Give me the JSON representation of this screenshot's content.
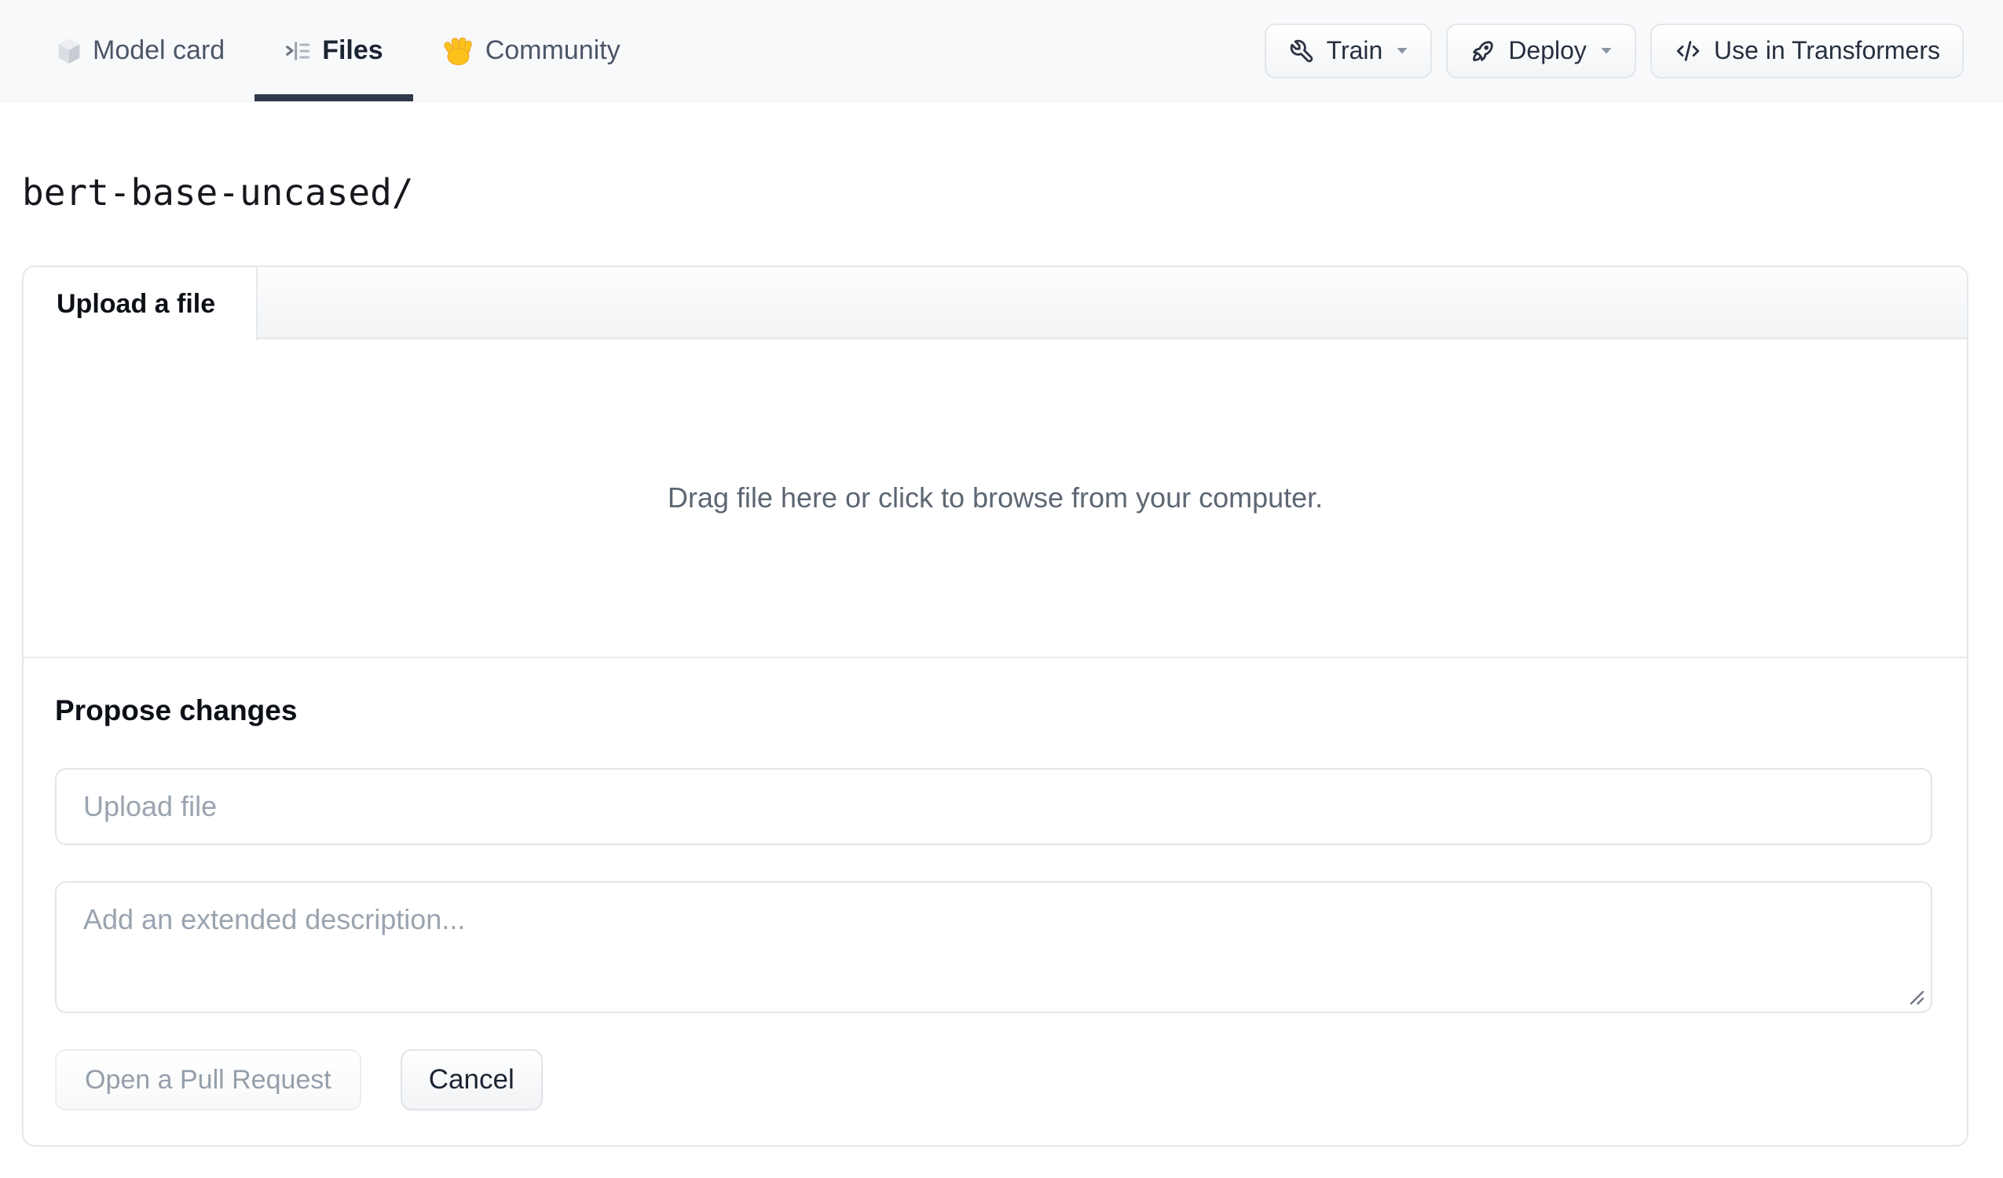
{
  "nav": {
    "tabs": [
      {
        "label": "Model card",
        "icon": "cube-icon",
        "active": false
      },
      {
        "label": "Files",
        "icon": "file-versions-icon",
        "active": true
      },
      {
        "label": "Community",
        "icon": "waving-hand-icon",
        "active": false
      }
    ],
    "actions": [
      {
        "label": "Train",
        "icon": "wrench-icon",
        "dropdown": true
      },
      {
        "label": "Deploy",
        "icon": "rocket-icon",
        "dropdown": true
      },
      {
        "label": "Use in Transformers",
        "icon": "code-icon",
        "dropdown": false
      }
    ]
  },
  "breadcrumb": {
    "repo_path": "bert-base-uncased/"
  },
  "upload_panel": {
    "tab_label": "Upload a file",
    "dropzone_hint": "Drag file here or click to browse from your computer.",
    "propose_heading": "Propose changes",
    "filename_placeholder": "Upload file",
    "description_placeholder": "Add an extended description...",
    "open_pr_label": "Open a Pull Request",
    "open_pr_enabled": false,
    "cancel_label": "Cancel"
  },
  "colors": {
    "nav_background": "#f8f9fb",
    "active_tab_underline": "#2e3a4b",
    "card_border": "#e5e8eb",
    "muted_text": "#5d6773",
    "placeholder_text": "#9aa4b0",
    "hand_emoji_yellow": "#fcc21b"
  }
}
